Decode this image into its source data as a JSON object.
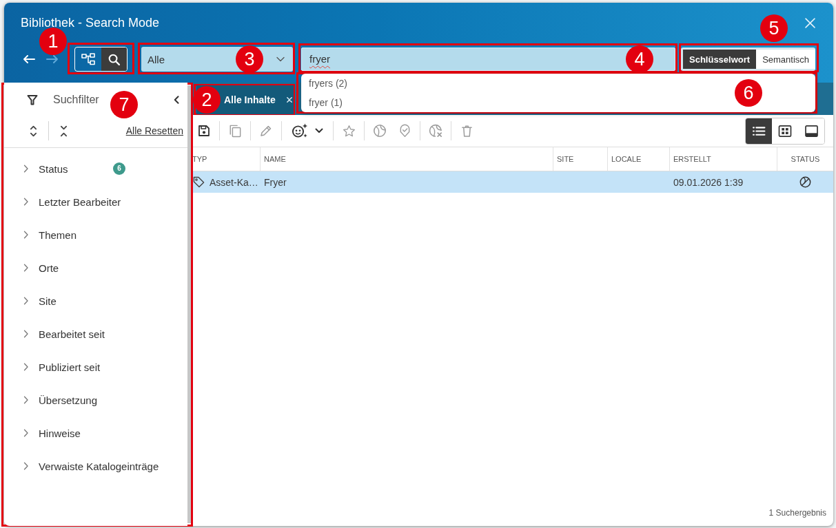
{
  "window": {
    "title": "Bibliothek - Search Mode"
  },
  "navigation": [
    {
      "kind": "back",
      "disabled": false
    },
    {
      "kind": "forward",
      "disabled": true
    }
  ],
  "mode_toggle": {
    "callout": "1",
    "options": [
      {
        "kind": "tree",
        "selected": false
      },
      {
        "kind": "search",
        "selected": true
      }
    ]
  },
  "type_filter": {
    "callout": "3",
    "value": "Alle"
  },
  "search": {
    "callout": "4",
    "value": "fryer",
    "suggestions": {
      "callout": "6",
      "items": [
        "fryers (2)",
        "fryer (1)"
      ]
    }
  },
  "search_mode": {
    "callout": "5",
    "options": [
      {
        "label": "Schlüsselwort",
        "selected": true
      },
      {
        "label": "Semantisch",
        "selected": false
      }
    ]
  },
  "sidebar": {
    "callout": "7",
    "title": "Suchfilter",
    "reset_link": "Alle Resetten",
    "filters": [
      {
        "label": "Status",
        "count": "6",
        "expanded": false
      },
      {
        "label": "Letzter Bearbeiter",
        "expanded": false
      },
      {
        "label": "Themen",
        "expanded": false
      },
      {
        "label": "Orte",
        "expanded": false
      },
      {
        "label": "Site",
        "expanded": false
      },
      {
        "label": "Bearbeitet seit",
        "expanded": false
      },
      {
        "label": "Publiziert seit",
        "expanded": false
      },
      {
        "label": "Übersetzung",
        "expanded": false
      },
      {
        "label": "Hinweise",
        "expanded": false
      },
      {
        "label": "Verwaiste Katalogeinträge",
        "expanded": false
      }
    ]
  },
  "tabs": {
    "callout": "2",
    "items": [
      {
        "label": "Alle Inhalte",
        "selected": true
      }
    ]
  },
  "toolbar": {
    "groups": [
      [
        {
          "kind": "save",
          "disabled": false
        }
      ],
      [
        {
          "kind": "copy",
          "disabled": true
        }
      ],
      [
        {
          "kind": "edit",
          "disabled": true
        }
      ],
      [
        {
          "kind": "ai",
          "disabled": false
        }
      ],
      [
        {
          "kind": "favorite",
          "disabled": true
        }
      ],
      [
        {
          "kind": "publish",
          "disabled": true
        },
        {
          "kind": "approve",
          "disabled": true
        }
      ],
      [
        {
          "kind": "withdraw",
          "disabled": true
        }
      ],
      [
        {
          "kind": "delete",
          "disabled": true
        }
      ]
    ],
    "views": [
      {
        "kind": "list",
        "selected": true
      },
      {
        "kind": "grid",
        "selected": false
      },
      {
        "kind": "panel",
        "selected": false
      }
    ]
  },
  "table": {
    "columns": [
      "TYP",
      "NAME",
      "SITE",
      "LOCALE",
      "ERSTELLT",
      "STATUS"
    ],
    "rows": [
      {
        "selected": true,
        "type": "Asset-Ka…",
        "name": "Fryer",
        "created": "09.01.2026 1:39",
        "status": {
          "kind": "unpublished"
        }
      }
    ]
  },
  "status_bar": {
    "text": "1 Suchergebnis"
  }
}
